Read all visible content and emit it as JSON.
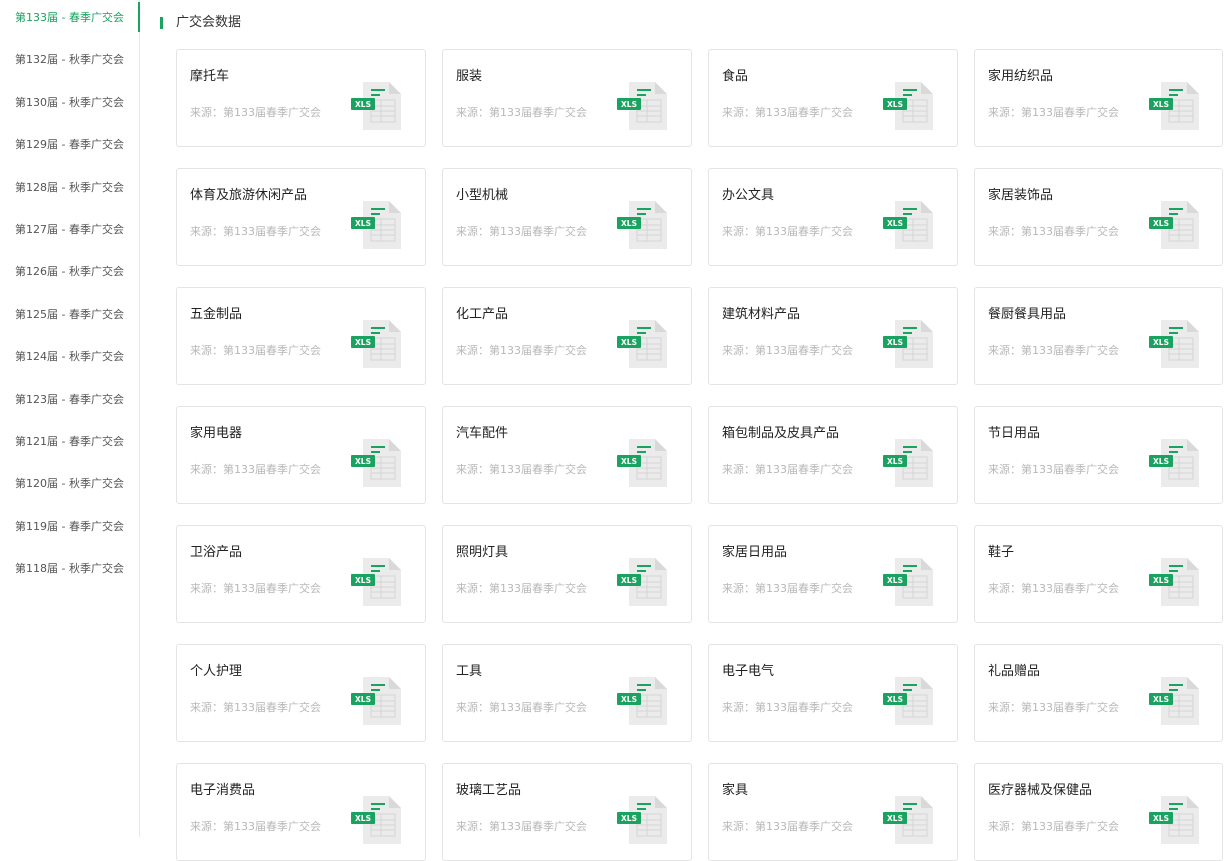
{
  "sidebar": {
    "items": [
      {
        "label": "第133届 - 春季广交会",
        "active": true
      },
      {
        "label": "第132届 - 秋季广交会",
        "active": false
      },
      {
        "label": "第130届 - 秋季广交会",
        "active": false
      },
      {
        "label": "第129届 - 春季广交会",
        "active": false
      },
      {
        "label": "第128届 - 秋季广交会",
        "active": false
      },
      {
        "label": "第127届 - 春季广交会",
        "active": false
      },
      {
        "label": "第126届 - 秋季广交会",
        "active": false
      },
      {
        "label": "第125届 - 春季广交会",
        "active": false
      },
      {
        "label": "第124届 - 秋季广交会",
        "active": false
      },
      {
        "label": "第123届 - 春季广交会",
        "active": false
      },
      {
        "label": "第121届 - 春季广交会",
        "active": false
      },
      {
        "label": "第120届 - 秋季广交会",
        "active": false
      },
      {
        "label": "第119届 - 春季广交会",
        "active": false
      },
      {
        "label": "第118届 - 秋季广交会",
        "active": false
      }
    ]
  },
  "main": {
    "title": "广交会数据",
    "file_badge": "XLS",
    "accent_color": "#1aa260",
    "cards": [
      {
        "name": "摩托车",
        "source": "来源：第133届春季广交会"
      },
      {
        "name": "服装",
        "source": "来源：第133届春季广交会"
      },
      {
        "name": "食品",
        "source": "来源：第133届春季广交会"
      },
      {
        "name": "家用纺织品",
        "source": "来源：第133届春季广交会"
      },
      {
        "name": "体育及旅游休闲产品",
        "source": "来源：第133届春季广交会"
      },
      {
        "name": "小型机械",
        "source": "来源：第133届春季广交会"
      },
      {
        "name": "办公文具",
        "source": "来源：第133届春季广交会"
      },
      {
        "name": "家居装饰品",
        "source": "来源：第133届春季广交会"
      },
      {
        "name": "五金制品",
        "source": "来源：第133届春季广交会"
      },
      {
        "name": "化工产品",
        "source": "来源：第133届春季广交会"
      },
      {
        "name": "建筑材料产品",
        "source": "来源：第133届春季广交会"
      },
      {
        "name": "餐厨餐具用品",
        "source": "来源：第133届春季广交会"
      },
      {
        "name": "家用电器",
        "source": "来源：第133届春季广交会"
      },
      {
        "name": "汽车配件",
        "source": "来源：第133届春季广交会"
      },
      {
        "name": "箱包制品及皮具产品",
        "source": "来源：第133届春季广交会"
      },
      {
        "name": "节日用品",
        "source": "来源：第133届春季广交会"
      },
      {
        "name": "卫浴产品",
        "source": "来源：第133届春季广交会"
      },
      {
        "name": "照明灯具",
        "source": "来源：第133届春季广交会"
      },
      {
        "name": "家居日用品",
        "source": "来源：第133届春季广交会"
      },
      {
        "name": "鞋子",
        "source": "来源：第133届春季广交会"
      },
      {
        "name": "个人护理",
        "source": "来源：第133届春季广交会"
      },
      {
        "name": "工具",
        "source": "来源：第133届春季广交会"
      },
      {
        "name": "电子电气",
        "source": "来源：第133届春季广交会"
      },
      {
        "name": "礼品赠品",
        "source": "来源：第133届春季广交会"
      },
      {
        "name": "电子消费品",
        "source": "来源：第133届春季广交会"
      },
      {
        "name": "玻璃工艺品",
        "source": "来源：第133届春季广交会"
      },
      {
        "name": "家具",
        "source": "来源：第133届春季广交会"
      },
      {
        "name": "医疗器械及保健品",
        "source": "来源：第133届春季广交会"
      }
    ]
  }
}
